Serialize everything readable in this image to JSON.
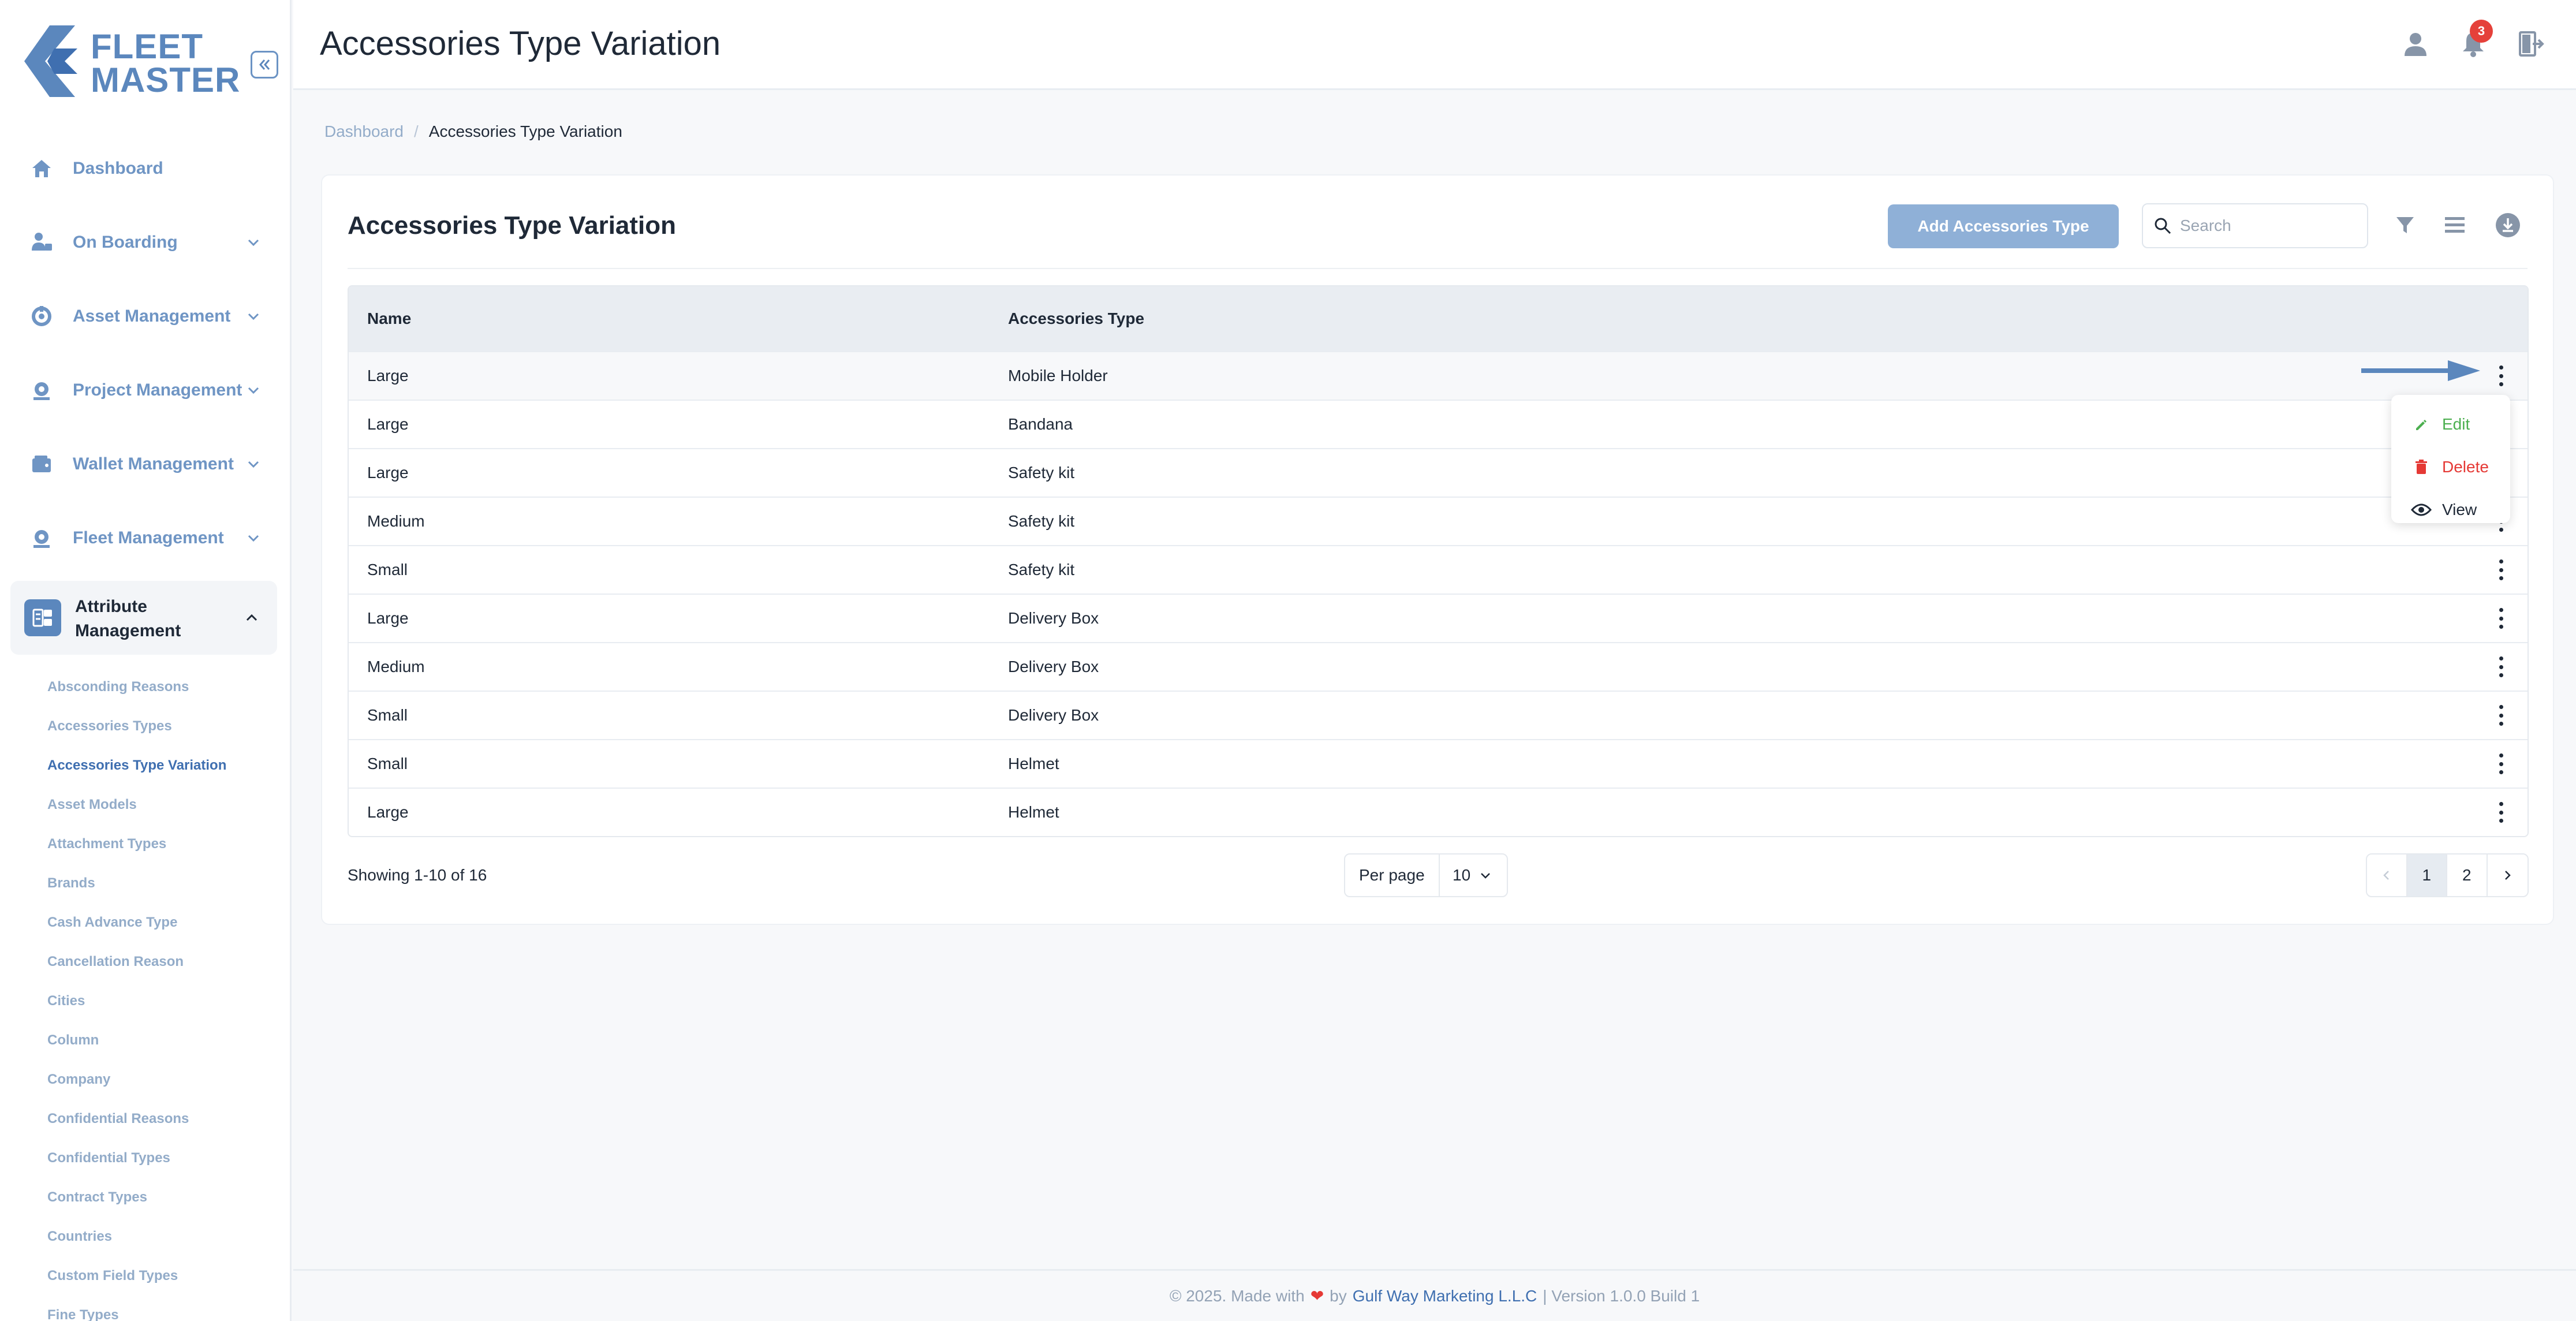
{
  "brand": {
    "line1": "FLEET",
    "line2": "MASTER"
  },
  "sidebar": {
    "items": [
      {
        "label": "Dashboard"
      },
      {
        "label": "On Boarding"
      },
      {
        "label": "Asset Management"
      },
      {
        "label": "Project Management"
      },
      {
        "label": "Wallet Management"
      },
      {
        "label": "Fleet Management"
      }
    ],
    "active_group": {
      "label_line1": "Attribute",
      "label_line2": "Management"
    },
    "sub_items": [
      "Absconding Reasons",
      "Accessories Types",
      "Accessories Type Variation",
      "Asset Models",
      "Attachment Types",
      "Brands",
      "Cash Advance Type",
      "Cancellation Reason",
      "Cities",
      "Column",
      "Company",
      "Confidential Reasons",
      "Confidential Types",
      "Contract Types",
      "Countries",
      "Custom Field Types",
      "Fine Types"
    ]
  },
  "header": {
    "title": "Accessories Type Variation",
    "notification_count": "3"
  },
  "breadcrumb": {
    "home": "Dashboard",
    "sep": "/",
    "current": "Accessories Type Variation"
  },
  "card": {
    "title": "Accessories Type Variation",
    "add_button": "Add Accessories Type",
    "search_placeholder": "Search",
    "search_value": ""
  },
  "table": {
    "columns": [
      "Name",
      "Accessories Type"
    ],
    "rows": [
      [
        "Large",
        "Mobile Holder"
      ],
      [
        "Large",
        "Bandana"
      ],
      [
        "Large",
        "Safety kit"
      ],
      [
        "Medium",
        "Safety kit"
      ],
      [
        "Small",
        "Safety kit"
      ],
      [
        "Large",
        "Delivery Box"
      ],
      [
        "Medium",
        "Delivery Box"
      ],
      [
        "Small",
        "Delivery Box"
      ],
      [
        "Small",
        "Helmet"
      ],
      [
        "Large",
        "Helmet"
      ]
    ]
  },
  "row_menu": {
    "edit": "Edit",
    "delete": "Delete",
    "view": "View"
  },
  "pagination": {
    "showing": "Showing 1-10 of 16",
    "per_page_label": "Per page",
    "per_page_value": "10",
    "pages": [
      "1",
      "2"
    ],
    "current_page": "1"
  },
  "footer": {
    "prefix": "© 2025. Made with",
    "by": "by",
    "company": "Gulf Way Marketing L.L.C",
    "suffix": "| Version 1.0.0 Build 1"
  },
  "colors": {
    "accent": "#5b87bd",
    "add_button": "#8fb0d7",
    "edit": "#4caf50",
    "delete": "#e53935",
    "badge": "#e5413a"
  }
}
